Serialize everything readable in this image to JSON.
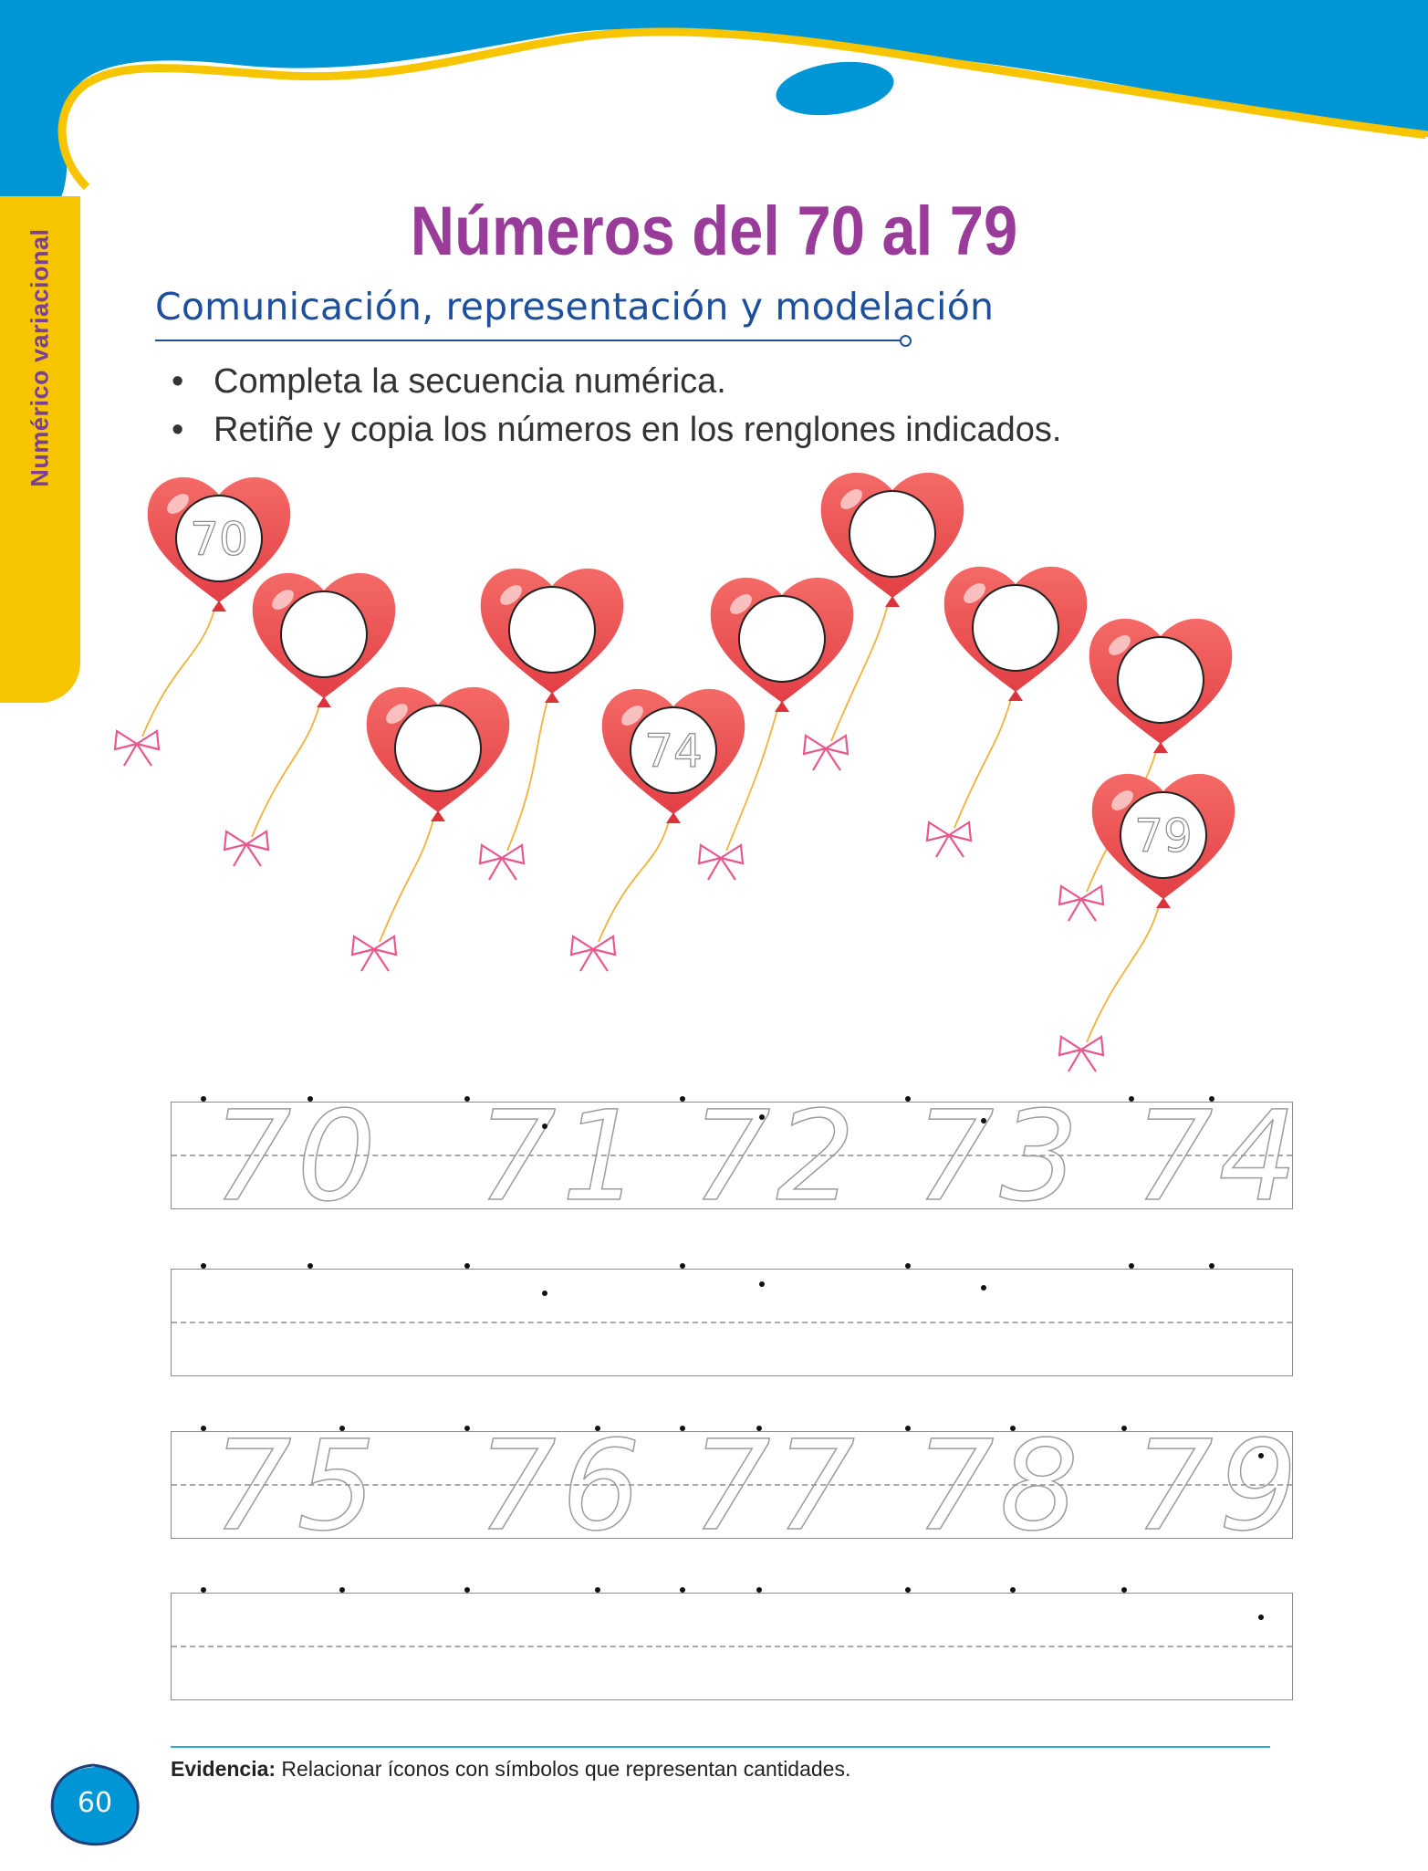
{
  "side_tab": {
    "label": "Numérico variacional"
  },
  "title": "Números del 70 al 79",
  "subtitle": "Comunicación, representación y modelación",
  "instructions": [
    "Completa la secuencia numérica.",
    "Retiñe y copia los números en los renglones indicados."
  ],
  "balloons": [
    {
      "number": "70"
    },
    {
      "number": ""
    },
    {
      "number": ""
    },
    {
      "number": ""
    },
    {
      "number": "74"
    },
    {
      "number": ""
    },
    {
      "number": ""
    },
    {
      "number": ""
    },
    {
      "number": ""
    },
    {
      "number": "79"
    }
  ],
  "writing_rows": [
    {
      "trace": [
        "70",
        "71",
        "72",
        "73",
        "74"
      ]
    },
    {
      "trace": []
    },
    {
      "trace": [
        "75",
        "76",
        "77",
        "78",
        "79"
      ]
    },
    {
      "trace": []
    }
  ],
  "footer": {
    "evidence_label": "Evidencia:",
    "evidence_text": " Relacionar íconos con símbolos que representan cantidades.",
    "page_number": "60"
  },
  "colors": {
    "header_blue": "#0096D6",
    "header_yellow": "#F6C500",
    "title_purple": "#993C99",
    "subtitle_blue": "#1E4F9C",
    "balloon_red": "#EE5455"
  }
}
